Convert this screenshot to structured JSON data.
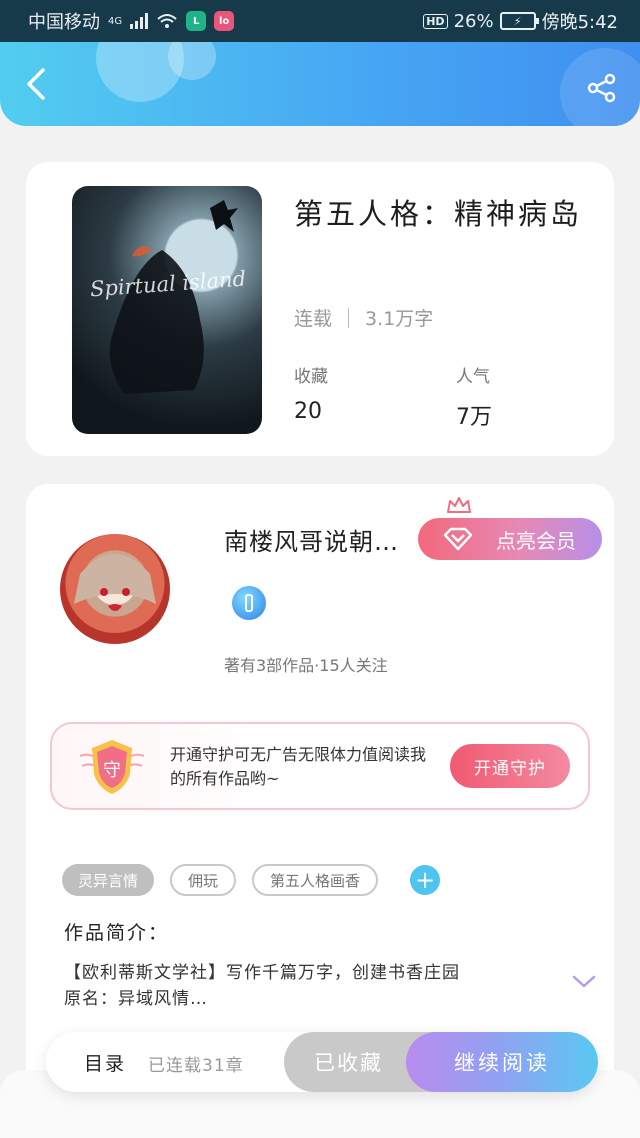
{
  "status_bar": {
    "carrier": "中国移动",
    "network": "4G",
    "hd": "HD",
    "battery_percent": "26%",
    "time": "傍晚5:42"
  },
  "header": {
    "back_icon": "chevron-left-icon",
    "share_icon": "share-icon"
  },
  "book": {
    "cover_text": "Spirtual island",
    "title": "第五人格：精神病岛",
    "status": "连载",
    "word_count": "3.1万字",
    "stats": [
      {
        "label": "收藏",
        "value": "20"
      },
      {
        "label": "人气",
        "value": "7万"
      }
    ]
  },
  "author": {
    "name": "南楼风哥说朝…",
    "vip_button": "点亮会员",
    "stats": "著有3部作品·15人关注"
  },
  "guard": {
    "icon_char": "守",
    "text": "开通守护可无广告无限体力值阅读我的所有作品哟~",
    "button": "开通守护"
  },
  "tags": [
    "灵异言情",
    "佣玩",
    "第五人格画香"
  ],
  "intro": {
    "heading": "作品简介：",
    "text_line1": "【欧利蒂斯文学社】写作千篇万字，创建书香庄园",
    "text_line2": "原名：异域风情…"
  },
  "bottom_bar": {
    "toc": "目录",
    "chapters": "已连载31章",
    "collected": "已收藏",
    "continue": "继续阅读"
  },
  "colors": {
    "header_start": "#52cdf0",
    "header_end": "#3f8ff0",
    "vip_pink": "#f2697c",
    "guard_pink": "#f15a72",
    "accent_blue": "#4fc4ee"
  }
}
